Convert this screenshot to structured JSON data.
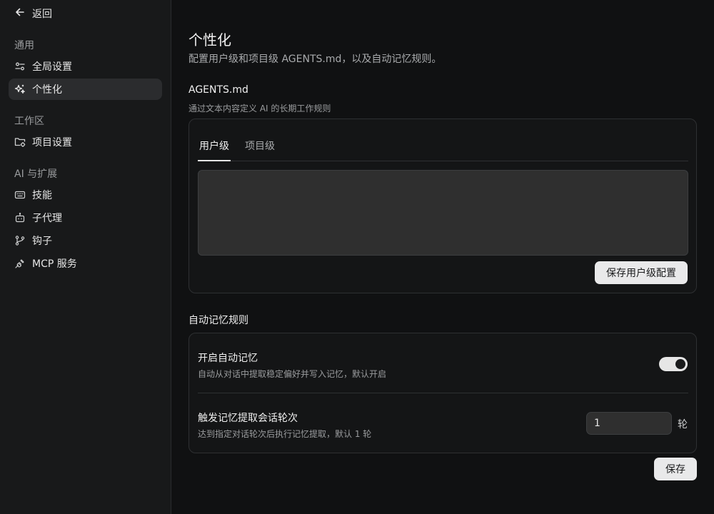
{
  "sidebar": {
    "back_label": "返回",
    "sections": [
      {
        "label": "通用",
        "items": [
          {
            "label": "全局设置",
            "icon": "sliders-icon"
          },
          {
            "label": "个性化",
            "icon": "sparkles-icon",
            "active": true
          }
        ]
      },
      {
        "label": "工作区",
        "items": [
          {
            "label": "项目设置",
            "icon": "folder-settings-icon"
          }
        ]
      },
      {
        "label": "AI 与扩展",
        "items": [
          {
            "label": "技能",
            "icon": "keyboard-icon"
          },
          {
            "label": "子代理",
            "icon": "bot-icon"
          },
          {
            "label": "钩子",
            "icon": "git-branch-icon"
          },
          {
            "label": "MCP 服务",
            "icon": "plug-icon"
          }
        ]
      }
    ]
  },
  "main": {
    "title": "个性化",
    "subtitle": "配置用户级和项目级 AGENTS.md，以及自动记忆规则。",
    "agents": {
      "title": "AGENTS.md",
      "description": "通过文本内容定义 AI 的长期工作规则",
      "tabs": [
        {
          "label": "用户级",
          "active": true
        },
        {
          "label": "项目级",
          "active": false
        }
      ],
      "textarea_value": "",
      "save_label": "保存用户级配置"
    },
    "memory": {
      "title": "自动记忆规则",
      "auto_title": "开启自动记忆",
      "auto_desc": "自动从对话中提取稳定偏好并写入记忆，默认开启",
      "auto_enabled": true,
      "trigger_title": "触发记忆提取会话轮次",
      "trigger_desc": "达到指定对话轮次后执行记忆提取，默认 1 轮",
      "trigger_value": "1",
      "trigger_unit": "轮",
      "save_label": "保存"
    }
  }
}
